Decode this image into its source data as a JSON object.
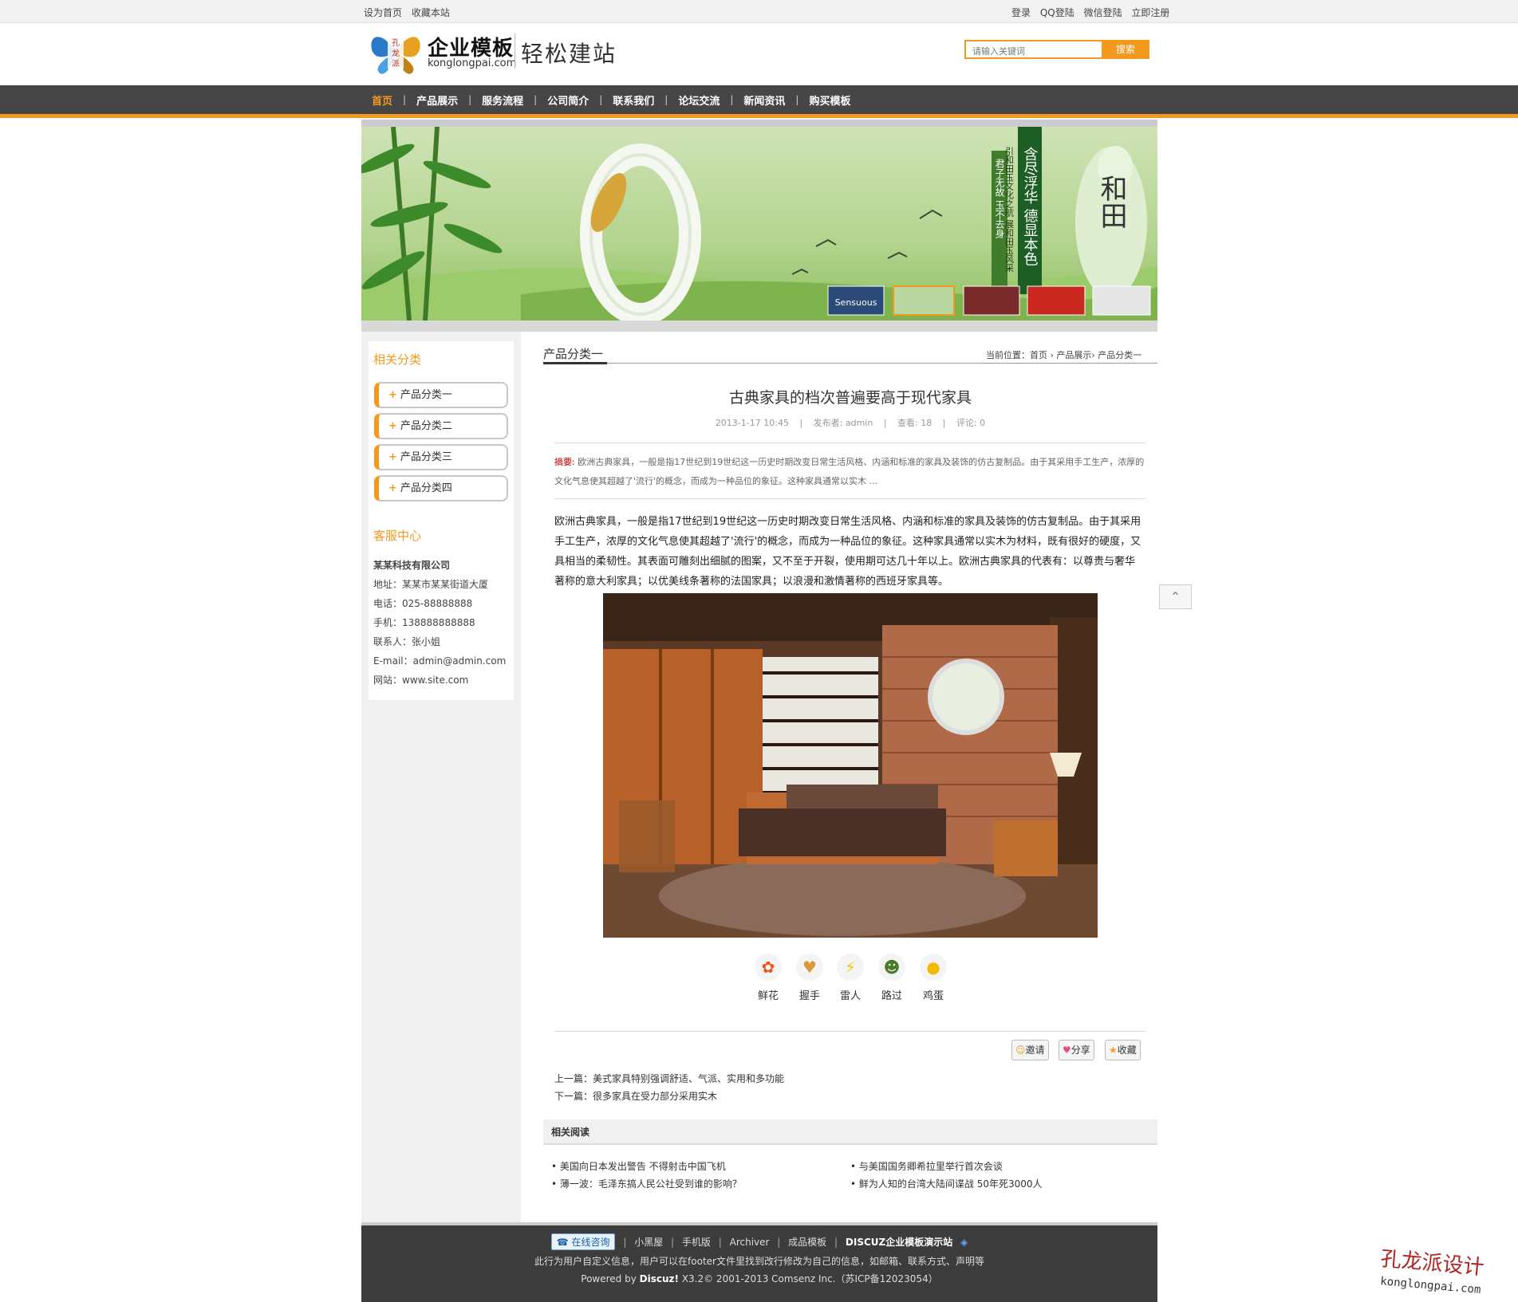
{
  "topbar": {
    "left": [
      "设为首页",
      "收藏本站"
    ],
    "right": [
      "登录",
      "QQ登陆",
      "微信登陆",
      "立即注册"
    ]
  },
  "header": {
    "logo_mark_text": "孔龙派",
    "logo_title": "企业模板",
    "logo_domain": "konglongpai.com",
    "slogan": "轻松建站",
    "search_placeholder": "请输入关键词",
    "search_button": "搜索"
  },
  "nav": {
    "items": [
      "首页",
      "产品展示",
      "服务流程",
      "公司简介",
      "联系我们",
      "论坛交流",
      "新闻资讯",
      "购买模板"
    ],
    "active_index": 0
  },
  "banner": {
    "vertical_texts": [
      "和田",
      "含尽浮华 德显本色",
      "引和田玉文化之航 展和田玉风采",
      "君子无故 玉不去身"
    ],
    "thumb_caption": "Sensuous"
  },
  "sidebar": {
    "related_title": "相关分类",
    "categories": [
      "产品分类一",
      "产品分类二",
      "产品分类三",
      "产品分类四"
    ],
    "service_title": "客服中心",
    "company": "某某科技有限公司",
    "contacts": [
      "地址：某某市某某街道大厦",
      "电话：025-88888888",
      "手机：138888888888",
      "联系人：张小姐",
      "E-mail：admin@admin.com",
      "网站：www.site.com"
    ]
  },
  "content": {
    "section_title": "产品分类一",
    "breadcrumb": "当前位置：首页 › 产品展示› 产品分类一",
    "article_title": "古典家具的档次普遍要高于现代家具",
    "meta": [
      "2013-1-17 10:45",
      "|",
      "发布者: admin",
      "|",
      "查看: 18",
      "|",
      "评论: 0"
    ],
    "summary_label": "摘要:",
    "summary_text": " 欧洲古典家具，一般是指17世纪到19世纪这一历史时期改变日常生活风格、内涵和标准的家具及装饰的仿古复制品。由于其采用手工生产，浓厚的文化气息使其超越了'流行'的概念，而成为一种品位的象征。这种家具通常以实木 ...",
    "body": "欧洲古典家具，一般是指17世纪到19世纪这一历史时期改变日常生活风格、内涵和标准的家具及装饰的仿古复制品。由于其采用手工生产，浓厚的文化气息使其超越了'流行'的概念，而成为一种品位的象征。这种家具通常以实木为材料，既有很好的硬度，又具相当的柔韧性。其表面可雕刻出细腻的图案，又不至于开裂，使用期可达几十年以上。欧洲古典家具的代表有：以尊贵与奢华著称的意大利家具；以优美线条著称的法国家具；以浪漫和激情著称的西班牙家具等。",
    "reactions": [
      {
        "label": "鲜花",
        "icon": "flower-icon",
        "glyph": "✿",
        "color": "#e8561c"
      },
      {
        "label": "握手",
        "icon": "handshake-icon",
        "glyph": "🤝",
        "color": "#d89a3c"
      },
      {
        "label": "雷人",
        "icon": "lightning-icon",
        "glyph": "⚡",
        "color": "#f2c21a"
      },
      {
        "label": "路过",
        "icon": "soldier-icon",
        "glyph": "☻",
        "color": "#4a7a2a"
      },
      {
        "label": "鸡蛋",
        "icon": "egg-icon",
        "glyph": "●",
        "color": "#f5b800"
      }
    ],
    "share_buttons": [
      "邀请",
      "分享",
      "收藏"
    ],
    "prev": "上一篇：美式家具特别强调舒适、气派、实用和多功能",
    "next": "下一篇：很多家具在受力部分采用实木",
    "related_title": "相关阅读",
    "related": [
      "• 美国向日本发出警告 不得射击中国飞机",
      "• 与美国国务卿希拉里举行首次会谈",
      "• 薄一波：毛泽东搞人民公社受到谁的影响？",
      "• 鲜为人知的台湾大陆间谍战 50年死3000人"
    ]
  },
  "footer": {
    "online_button": "在线咨询",
    "links": [
      "小黑屋",
      "手机版",
      "Archiver",
      "成品模板"
    ],
    "site_name": "DISCUZ企业模板演示站",
    "line2": "此行为用户自定义信息，用户可以在footer文件里找到改行修改为自己的信息，如邮箱、联系方式、声明等",
    "powered_prefix": "Powered by ",
    "powered_brand": "Discuz!",
    "powered_rest": " X3.2© 2001-2013 Comsenz Inc.（苏ICP备12023054）"
  },
  "watermark": {
    "line1": "孔龙派设计",
    "line2": "konglongpai.com"
  },
  "colors": {
    "accent": "#f39a1e",
    "nav_bg": "#464646",
    "footer_bg": "#3c3c3c"
  }
}
